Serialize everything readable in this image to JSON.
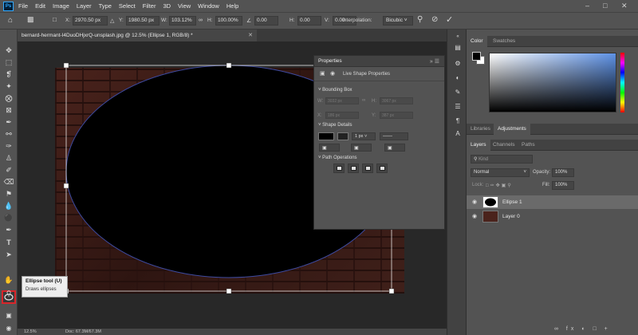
{
  "menubar": {
    "items": [
      "File",
      "Edit",
      "Image",
      "Layer",
      "Type",
      "Select",
      "Filter",
      "3D",
      "View",
      "Window",
      "Help"
    ],
    "logo_text": "Ps"
  },
  "options": {
    "x_label": "X:",
    "x_value": "2970.50 px",
    "y_label": "Y:",
    "y_value": "1980.50 px",
    "w_label": "W:",
    "w_value": "103.12%",
    "h_label": "H:",
    "h_value": "100.00%",
    "angle_value": "0.00",
    "hskew_label": "H:",
    "hskew_value": "0.00",
    "vskew_label": "V:",
    "vskew_value": "0.00",
    "interp_label": "Interpolation:",
    "interp_value": "Bicubic"
  },
  "document": {
    "tab_title": "bernard-hermant-I4DuoDHjxrQ-unsplash.jpg @ 12.5% (Ellipse 1, RGB/8) *"
  },
  "tooltip": {
    "title": "Ellipse tool (U)",
    "description": "Draws ellipses"
  },
  "status": {
    "zoom": "12.5%",
    "doc": "Doc: 67.3M/67.3M"
  },
  "properties": {
    "title": "Properties",
    "subtitle": "Live Shape Properties",
    "bounding_box": "Bounding Box",
    "w_label": "W:",
    "w_value": "3032 px",
    "h_label": "H:",
    "h_value": "3067 px",
    "x_label": "X:",
    "x_value": "186 px",
    "y_label": "Y:",
    "y_value": "387 px",
    "shape_details": "Shape Details",
    "stroke_size": "1 px",
    "path_operations": "Path Operations"
  },
  "color_panel": {
    "tabs": [
      "Color",
      "Swatches"
    ],
    "hue_color": "#5e92e6"
  },
  "lib_panel": {
    "tabs": [
      "Libraries",
      "Adjustments"
    ]
  },
  "layers_panel": {
    "tabs": [
      "Layers",
      "Channels",
      "Paths"
    ],
    "filter_placeholder": "Kind",
    "blend_mode": "Normal",
    "opacity_label": "Opacity:",
    "opacity_value": "100%",
    "lock_label": "Lock:",
    "fill_label": "Fill:",
    "fill_value": "100%",
    "layers": [
      {
        "name": "Ellipse 1",
        "selected": true
      },
      {
        "name": "Layer 0",
        "selected": false
      }
    ]
  },
  "colors": {
    "accent_red": "#d9252a",
    "ellipse_fill": "#000000",
    "selection_stroke": "#3d4aa0"
  }
}
